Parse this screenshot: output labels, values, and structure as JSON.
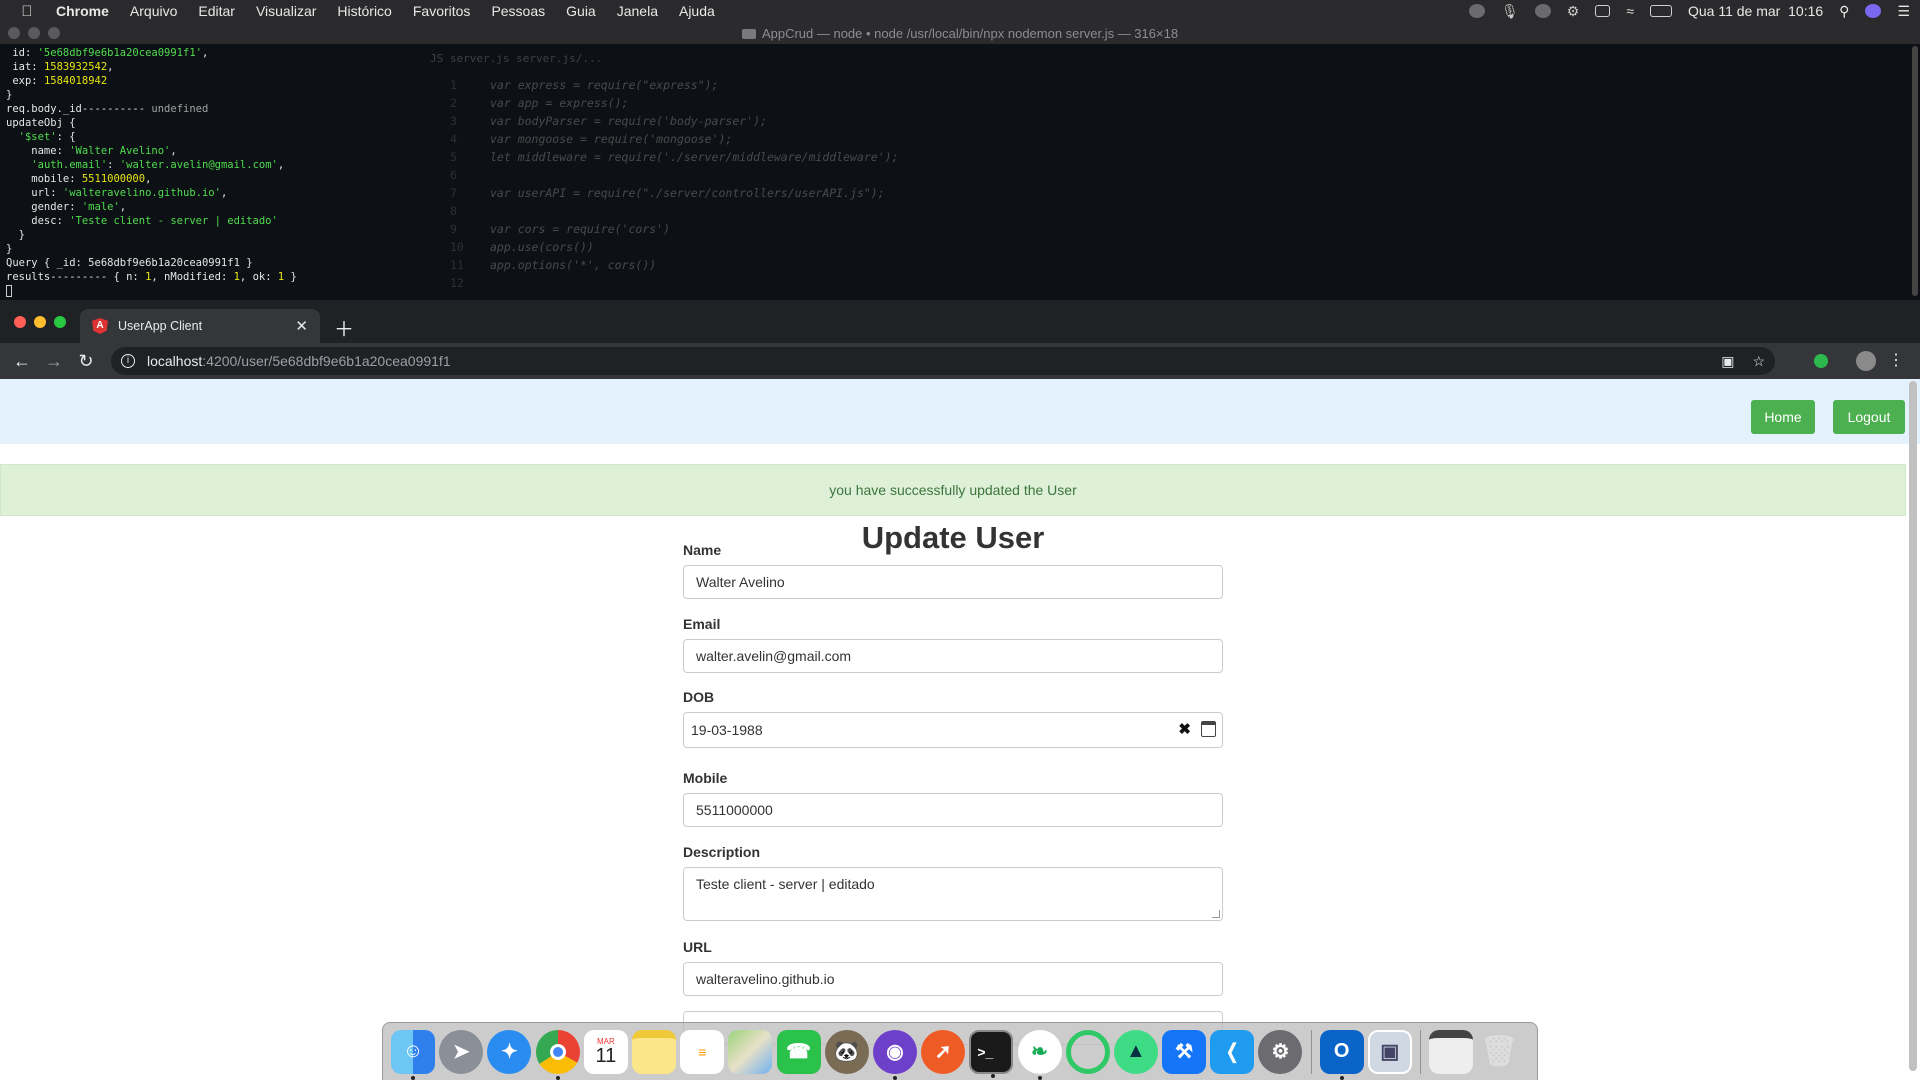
{
  "menubar": {
    "app": "Chrome",
    "items": [
      "Arquivo",
      "Editar",
      "Visualizar",
      "Histórico",
      "Favoritos",
      "Pessoas",
      "Guia",
      "Janela",
      "Ajuda"
    ],
    "datetime": "Qua 11 de mar  10:16"
  },
  "terminal": {
    "title": "AppCrud — node • node /usr/local/bin/npx nodemon server.js — 316×18",
    "lines": [
      {
        "segments": [
          {
            "t": " id: ",
            "c": ""
          },
          {
            "t": "'5e68dbf9e6b1a20cea0991f1'",
            "c": "tg"
          },
          {
            "t": ",",
            "c": ""
          }
        ]
      },
      {
        "segments": [
          {
            "t": " iat: ",
            "c": ""
          },
          {
            "t": "1583932542",
            "c": "ty"
          },
          {
            "t": ",",
            "c": ""
          }
        ]
      },
      {
        "segments": [
          {
            "t": " exp: ",
            "c": ""
          },
          {
            "t": "1584018942",
            "c": "ty"
          }
        ]
      },
      {
        "segments": [
          {
            "t": "}",
            "c": ""
          }
        ]
      },
      {
        "segments": [
          {
            "t": "req.body._id---------- ",
            "c": ""
          },
          {
            "t": "undefined",
            "c": "tgray"
          }
        ]
      },
      {
        "segments": [
          {
            "t": "updateObj {",
            "c": ""
          }
        ]
      },
      {
        "segments": [
          {
            "t": "  ",
            "c": ""
          },
          {
            "t": "'$set'",
            "c": "tg"
          },
          {
            "t": ": {",
            "c": ""
          }
        ]
      },
      {
        "segments": [
          {
            "t": "    name: ",
            "c": ""
          },
          {
            "t": "'Walter Avelino'",
            "c": "tg"
          },
          {
            "t": ",",
            "c": ""
          }
        ]
      },
      {
        "segments": [
          {
            "t": "    ",
            "c": ""
          },
          {
            "t": "'auth.email'",
            "c": "tg"
          },
          {
            "t": ": ",
            "c": ""
          },
          {
            "t": "'walter.avelin@gmail.com'",
            "c": "tg"
          },
          {
            "t": ",",
            "c": ""
          }
        ]
      },
      {
        "segments": [
          {
            "t": "    mobile: ",
            "c": ""
          },
          {
            "t": "5511000000",
            "c": "ty"
          },
          {
            "t": ",",
            "c": ""
          }
        ]
      },
      {
        "segments": [
          {
            "t": "    url: ",
            "c": ""
          },
          {
            "t": "'walteravelino.github.io'",
            "c": "tg"
          },
          {
            "t": ",",
            "c": ""
          }
        ]
      },
      {
        "segments": [
          {
            "t": "    gender: ",
            "c": ""
          },
          {
            "t": "'male'",
            "c": "tg"
          },
          {
            "t": ",",
            "c": ""
          }
        ]
      },
      {
        "segments": [
          {
            "t": "    desc: ",
            "c": ""
          },
          {
            "t": "'Teste client - server | editado'",
            "c": "tg"
          }
        ]
      },
      {
        "segments": [
          {
            "t": "  }",
            "c": ""
          }
        ]
      },
      {
        "segments": [
          {
            "t": "}",
            "c": ""
          }
        ]
      },
      {
        "segments": [
          {
            "t": "Query { _id: 5e68dbf9e6b1a20cea0991f1 }",
            "c": ""
          }
        ]
      },
      {
        "segments": [
          {
            "t": "results--------- { n: ",
            "c": ""
          },
          {
            "t": "1",
            "c": "ty"
          },
          {
            "t": ", nModified: ",
            "c": ""
          },
          {
            "t": "1",
            "c": "ty"
          },
          {
            "t": ", ok: ",
            "c": ""
          },
          {
            "t": "1",
            "c": "ty"
          },
          {
            "t": " }",
            "c": ""
          }
        ]
      }
    ],
    "background_editor": {
      "tab": "JS  server.js  server.js/...",
      "code": [
        {
          "n": "1",
          "t": "var express = require(\"express\");"
        },
        {
          "n": "2",
          "t": "var app = express();"
        },
        {
          "n": "3",
          "t": "var bodyParser = require('body-parser');"
        },
        {
          "n": "4",
          "t": "var mongoose = require('mongoose');"
        },
        {
          "n": "5",
          "t": "let middleware = require('./server/middleware/middleware');"
        },
        {
          "n": "6",
          "t": ""
        },
        {
          "n": "7",
          "t": "var userAPI = require(\"./server/controllers/userAPI.js\");"
        },
        {
          "n": "8",
          "t": ""
        },
        {
          "n": "9",
          "t": "var cors = require('cors')"
        },
        {
          "n": "10",
          "t": "app.use(cors())"
        },
        {
          "n": "11",
          "t": "app.options('*', cors())"
        },
        {
          "n": "12",
          "t": ""
        }
      ]
    }
  },
  "browser": {
    "tab_title": "UserApp Client",
    "favicon_letter": "A",
    "url_host": "localhost",
    "url_path": ":4200/user/5e68dbf9e6b1a20cea0991f1"
  },
  "page": {
    "nav": {
      "home": "Home",
      "logout": "Logout"
    },
    "alert": "you have successfully updated the User",
    "title": "Update User",
    "fields": {
      "name": {
        "label": "Name",
        "value": "Walter Avelino"
      },
      "email": {
        "label": "Email",
        "value": "walter.avelin@gmail.com"
      },
      "dob": {
        "label": "DOB",
        "value": "19-03-1988"
      },
      "mobile": {
        "label": "Mobile",
        "value": "5511000000"
      },
      "description": {
        "label": "Description",
        "value": "Teste client - server | editado"
      },
      "url": {
        "label": "URL",
        "value": "walteravelino.github.io"
      }
    }
  },
  "dock": {
    "calendar_month": "MAR",
    "calendar_day": "11",
    "apps": [
      "finder-icon",
      "launchpad-icon",
      "safari-icon",
      "chrome-icon",
      "calendar-icon",
      "notes-icon",
      "reminders-icon",
      "maps-icon",
      "facetime-icon",
      "gimp-icon",
      "github-desktop-icon",
      "postman-icon",
      "terminal-icon",
      "mongodb-compass-icon",
      "robo3t-icon",
      "android-studio-icon",
      "xcode-icon",
      "vscode-icon",
      "system-preferences-icon",
      "outlook-icon",
      "preview-icon",
      "downloads-icon",
      "trash-icon"
    ]
  },
  "colors": {
    "navbar_bg": "#e3f2fd",
    "button_green": "#4caf50",
    "alert_bg": "#dff0d8",
    "alert_text": "#3c763d"
  }
}
